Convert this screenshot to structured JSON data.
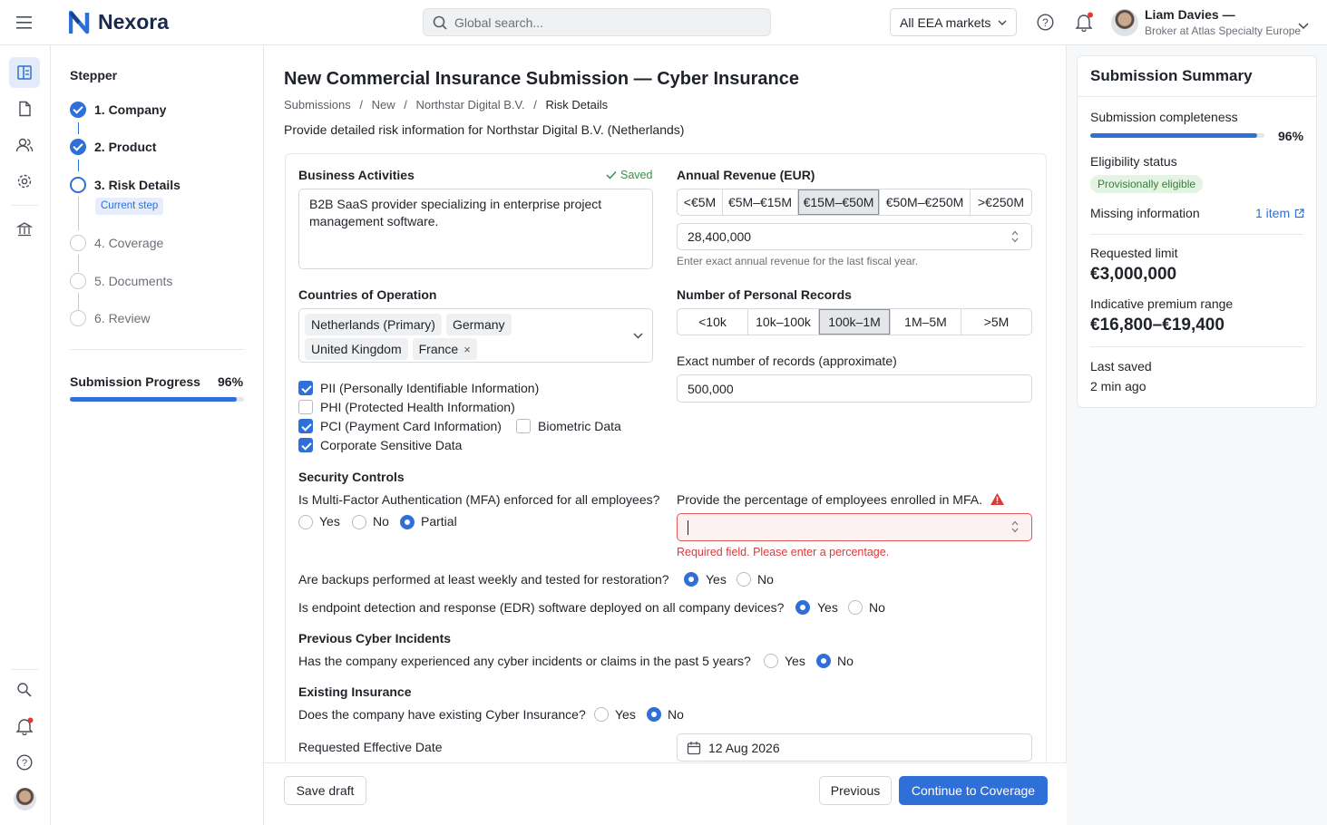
{
  "brand": {
    "name": "Nexora"
  },
  "search": {
    "placeholder": "Global search..."
  },
  "market": {
    "label": "All EEA markets"
  },
  "user": {
    "name": "Liam Davies —",
    "role": "Broker at Atlas Specialty Europe"
  },
  "stepper": {
    "title": "Stepper",
    "steps": [
      {
        "label": "1. Company",
        "state": "done"
      },
      {
        "label": "2. Product",
        "state": "done"
      },
      {
        "label": "3. Risk Details",
        "state": "current",
        "badge": "Current step"
      },
      {
        "label": "4. Coverage",
        "state": "todo"
      },
      {
        "label": "5. Documents",
        "state": "todo"
      },
      {
        "label": "6. Review",
        "state": "todo"
      }
    ],
    "progress_label": "Submission Progress",
    "progress_value": "96%",
    "progress_fraction": 0.96
  },
  "page": {
    "title": "New Commercial Insurance Submission — Cyber Insurance",
    "breadcrumb": [
      "Submissions",
      "New",
      "Northstar Digital B.V.",
      "Risk Details"
    ],
    "subtitle": "Provide detailed risk information for Northstar Digital B.V. (Netherlands)"
  },
  "form": {
    "business": {
      "label": "Business Activities",
      "saved": "Saved",
      "value": "B2B SaaS provider specializing in enterprise project management software."
    },
    "revenue": {
      "label": "Annual Revenue (EUR)",
      "options": [
        "<€5M",
        "€5M–€15M",
        "€15M–€50M",
        "€50M–€250M",
        ">€250M"
      ],
      "selected": "€15M–€50M",
      "value": "28,400,000",
      "help": "Enter exact annual revenue for the last fiscal year."
    },
    "countries": {
      "label": "Countries of Operation",
      "chips": [
        "Netherlands (Primary)",
        "Germany",
        "United Kingdom"
      ],
      "removable_chip": "France",
      "remove_symbol": "×"
    },
    "records": {
      "label": "Number of Personal Records",
      "options": [
        "<10k",
        "10k–100k",
        "100k–1M",
        "1M–5M",
        ">5M"
      ],
      "selected": "100k–1M",
      "exact_label": "Exact number of records (approximate)",
      "exact_value": "500,000"
    },
    "data_types": {
      "pii": {
        "label": "PII (Personally Identifiable Information)",
        "checked": true
      },
      "phi": {
        "label": "PHI (Protected Health Information)",
        "checked": false
      },
      "pci": {
        "label": "PCI (Payment Card Information)",
        "checked": true
      },
      "biometric": {
        "label": "Biometric Data",
        "checked": false
      },
      "corporate": {
        "label": "Corporate Sensitive Data",
        "checked": true
      }
    },
    "security": {
      "title": "Security Controls",
      "mfa_question": "Is Multi-Factor Authentication (MFA) enforced for all employees?",
      "mfa_options": [
        "Yes",
        "No",
        "Partial"
      ],
      "mfa_selected": "Partial",
      "mfa_pct_label": "Provide the percentage of employees enrolled in MFA.",
      "mfa_pct_value": "",
      "mfa_error": "Required field. Please enter a percentage.",
      "backup_question": "Are backups performed at least weekly and tested for restoration?",
      "backup_selected": "Yes",
      "edr_question": "Is endpoint detection and response (EDR) software deployed on all company devices?",
      "edr_selected": "Yes",
      "yes": "Yes",
      "no": "No"
    },
    "incidents": {
      "title": "Previous Cyber Incidents",
      "question": "Has the company experienced any cyber incidents or claims in the past 5 years?",
      "selected": "No"
    },
    "existing": {
      "title": "Existing Insurance",
      "question": "Does the company have existing Cyber Insurance?",
      "selected": "No"
    },
    "effective_date": {
      "label": "Requested Effective Date",
      "value": "12 Aug 2026"
    }
  },
  "footer": {
    "save_draft": "Save draft",
    "previous": "Previous",
    "continue": "Continue to Coverage"
  },
  "summary": {
    "title": "Submission Summary",
    "completeness_label": "Submission completeness",
    "completeness_value": "96%",
    "completeness_fraction": 0.96,
    "eligibility_label": "Eligibility status",
    "eligibility_badge": "Provisionally eligible",
    "missing_label": "Missing information",
    "missing_link": "1 item",
    "limit_label": "Requested limit",
    "limit_value": "€3,000,000",
    "premium_label": "Indicative premium range",
    "premium_value": "€16,800–€19,400",
    "saved_label": "Last saved",
    "saved_value": "2 min ago"
  },
  "colors": {
    "accent": "#2f6fd8",
    "error": "#d93a3a",
    "success_bg": "#e3f4e3",
    "success_text": "#3a7d3a"
  }
}
